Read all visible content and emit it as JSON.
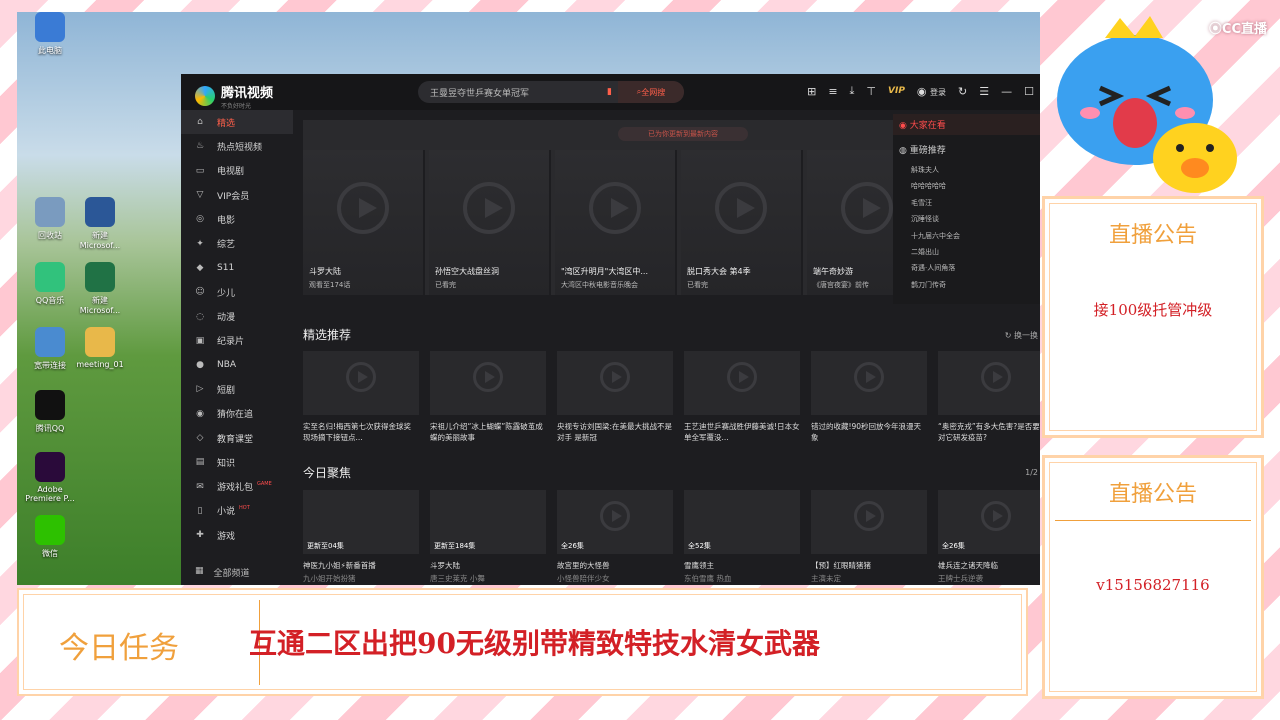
{
  "desktop": {
    "icons": [
      {
        "label": "此电脑",
        "icon": "computer-icon",
        "color": "#3a7bd5"
      },
      {
        "label": "回收站",
        "icon": "recycle-bin-icon",
        "color": "#7a9bbf"
      },
      {
        "label": "QQ音乐",
        "icon": "qq-music-icon",
        "color": "#31c27c"
      },
      {
        "label": "宽带连接",
        "icon": "network-icon",
        "color": "#4a8bd0"
      },
      {
        "label": "腾讯QQ",
        "icon": "qq-icon",
        "color": "#111"
      },
      {
        "label": "Adobe Premiere P...",
        "icon": "premiere-icon",
        "color": "#2a0a3a"
      },
      {
        "label": "微信",
        "icon": "wechat-icon",
        "color": "#2dc100"
      },
      {
        "label": "新建 Microsof...",
        "icon": "word-doc-icon",
        "color": "#2b5797"
      },
      {
        "label": "新建 Microsof...",
        "icon": "excel-doc-icon",
        "color": "#207245"
      },
      {
        "label": "meeting_01",
        "icon": "folder-icon",
        "color": "#e8b84a"
      }
    ]
  },
  "app": {
    "logo": "腾讯视频",
    "logo_slogan": "不负好时光",
    "search": {
      "placeholder": "王曼昱夺世乒赛女单冠军",
      "button": "全网搜"
    },
    "vip": "VIP",
    "login": "登录",
    "sidebar": [
      {
        "label": "精选",
        "icon": "home-icon"
      },
      {
        "label": "热点短视频",
        "icon": "fire-icon"
      },
      {
        "label": "电视剧",
        "icon": "tv-icon"
      },
      {
        "label": "VIP会员",
        "icon": "vip-icon"
      },
      {
        "label": "电影",
        "icon": "film-icon"
      },
      {
        "label": "综艺",
        "icon": "star-icon"
      },
      {
        "label": "S11",
        "icon": "game-icon"
      },
      {
        "label": "少儿",
        "icon": "kids-icon"
      },
      {
        "label": "动漫",
        "icon": "anime-icon"
      },
      {
        "label": "纪录片",
        "icon": "camera-icon"
      },
      {
        "label": "NBA",
        "icon": "nba-icon"
      },
      {
        "label": "短剧",
        "icon": "play-icon"
      },
      {
        "label": "猜你在追",
        "icon": "eye-icon"
      },
      {
        "label": "教育课堂",
        "icon": "edu-icon"
      },
      {
        "label": "知识",
        "icon": "book-icon"
      },
      {
        "label": "游戏礼包",
        "icon": "gift-icon",
        "tag": "GAME"
      },
      {
        "label": "小说",
        "icon": "novel-icon",
        "tag": "HOT"
      },
      {
        "label": "游戏",
        "icon": "controller-icon"
      }
    ],
    "all_channels": "全部频道",
    "banner_tag": "已为你更新到最新内容",
    "banner_items": [
      {
        "title": "斗罗大陆",
        "sub": "观看至174话"
      },
      {
        "title": "孙悟空大战盘丝洞",
        "sub": "已看完"
      },
      {
        "title": "\"湾区升明月\"大湾区中...",
        "sub": "大湾区中秋电影音乐晚会"
      },
      {
        "title": "脱口秀大会 第4季",
        "sub": "已看完"
      },
      {
        "title": "端午奇妙游",
        "sub": "《唐宫夜宴》前传"
      }
    ],
    "hot": {
      "title": "大家在看",
      "subtitle": "重磅推荐",
      "items": [
        "斛珠夫人",
        "哈哈哈哈哈",
        "毛雪汪",
        "沉睡怪谈",
        "十九届六中全会",
        "二婚出山",
        "奇遇·人间角落",
        "鹊刀门传奇"
      ]
    },
    "section1": {
      "title": "精选推荐",
      "more": "换一换",
      "items": [
        "实至名归!梅西第七次获得金球奖 现场摘下接钮点...",
        "宋祖儿介绍“冰上蝴蝶”陈露破茧成蝶的美丽故事",
        "央视专访刘国梁:在美最大挑战不是对手 是新冠",
        "王艺迪世乒赛战胜伊藤美诚!日本女单全军覆没...",
        "错过的收藏!90秒回放今年浪漫天象",
        "“奥密克戎”有多大危害?是否要针对它研发疫苗?"
      ]
    },
    "section2": {
      "title": "今日聚焦",
      "page": "1/2",
      "items": [
        {
          "title": "神医九小姐⚡新番首播",
          "badge": "更新至04集",
          "sub": "九小姐开始扮猪"
        },
        {
          "title": "斗罗大陆",
          "badge": "更新至184集",
          "sub": "唐三史莱克 小舞"
        },
        {
          "title": "故宫里的大怪兽",
          "badge": "全26集",
          "sub": "小怪兽陪伴少女"
        },
        {
          "title": "雪鹰领主",
          "badge": "全52集",
          "sub": "东伯雪鹰 热血"
        },
        {
          "title": "【预】红眼睛猪猪",
          "badge": "",
          "sub": "主演未定"
        },
        {
          "title": "雄兵连之诸天降临",
          "badge": "全26集",
          "sub": "王牌士兵逆袭"
        }
      ]
    }
  },
  "overlay": {
    "brand": "CC直播",
    "notice1": {
      "title": "直播公告",
      "body": "接100级托管冲级"
    },
    "notice2": {
      "title": "直播公告",
      "body": "v15156827116"
    },
    "task": {
      "label": "今日任务",
      "text": "互通二区出把90无级别带精致特技水清女武器"
    }
  }
}
